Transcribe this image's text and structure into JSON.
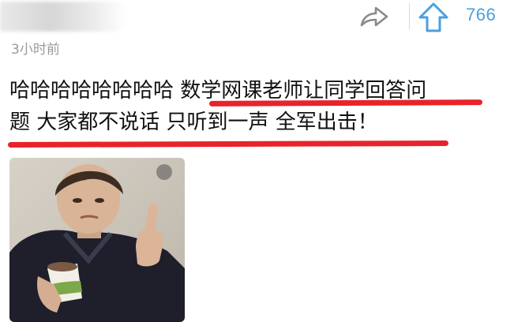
{
  "post": {
    "author_placeholder": "",
    "timestamp": "3小时前",
    "vote_count": "766",
    "text_plain": "哈哈哈哈哈哈哈哈 ",
    "text_highlight_line1": "数学网课老师让同学回答问",
    "text_highlight_line2": "题 大家都不说话 只听到一声 全军出击！"
  },
  "icons": {
    "share": "share-arrow-icon",
    "upvote": "upvote-arrow-icon"
  },
  "colors": {
    "accent_blue": "#4a9fe0",
    "underline_red": "#e8232a",
    "timestamp_gray": "#9a9a9a",
    "icon_gray": "#8a8a8a"
  }
}
